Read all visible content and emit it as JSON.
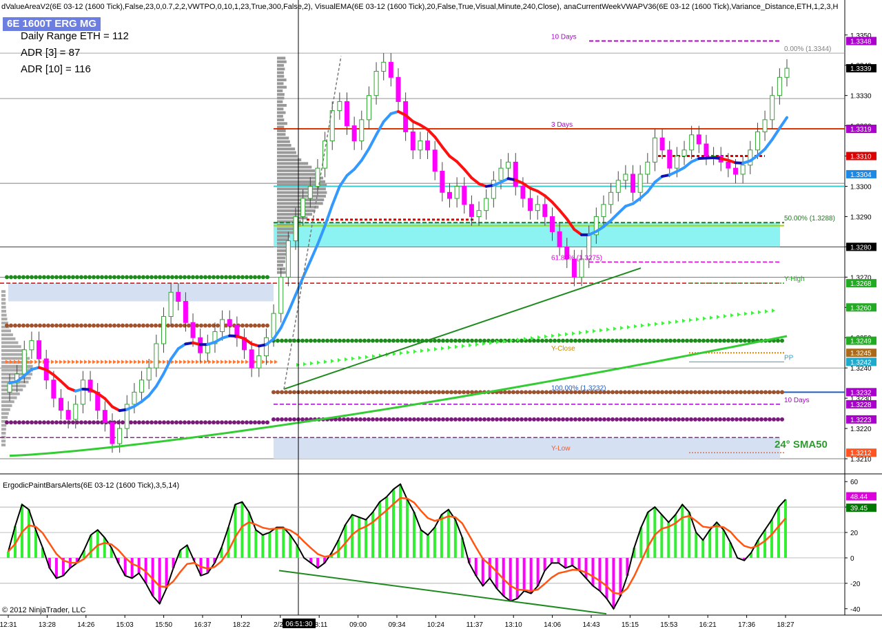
{
  "header": {
    "indicators": "dValueAreaV2(6E 03-12 (1600 Tick),False,23,0,0.7,2,2,VWTPO,0,10,1,23,True,300,False,2),  VisualEMA(6E 03-12 (1600 Tick),20,False,True,Visual,Minute,240,Close),  anaCurrentWeekVWAPV36(6E 03-12 (1600 Tick),Variance_Distance,ETH,1,2,3,H"
  },
  "symbol_badge": "6E 1600T ERG MG",
  "stats": [
    "Daily Range ETH = 112",
    "ADR [3] = 87",
    "ADR [10] = 116"
  ],
  "sma_label": "24° SMA50",
  "subpanel_title": "ErgodicPaintBarsAlerts(6E 03-12 (1600 Tick),3,5,14)",
  "copyright": "© 2012 NinjaTrader, LLC",
  "colors": {
    "up_candle": "#2ea52e",
    "down_candle": "#ff00ff",
    "ema_up": "#3399ff",
    "ema_down": "#ff1010",
    "ema_flat": "#1010b0",
    "sma": "#33cc33",
    "value_area": "#66eeee",
    "hist_up": "#33ee33",
    "hist_down": "#ff00ff"
  },
  "chart_data": [
    {
      "type": "candlestick",
      "name": "price",
      "ylim": [
        1.3205,
        1.3357
      ],
      "y_ticks": [
        "1.3210",
        "1.3220",
        "1.3230",
        "1.3240",
        "1.3250",
        "1.3260",
        "1.3270",
        "1.3280",
        "1.3290",
        "1.3300",
        "1.3310",
        "1.3320",
        "1.3330",
        "1.3340",
        "1.3350"
      ],
      "x_ticks": [
        "12:31",
        "13:28",
        "14:26",
        "15:03",
        "15:50",
        "16:37",
        "18:22",
        "2/28",
        "08:11",
        "09:00",
        "09:34",
        "10:24",
        "11:37",
        "13:10",
        "14:06",
        "14:43",
        "15:15",
        "15:53",
        "16:21",
        "17:36",
        "18:27"
      ],
      "crosshair_label": "06:51:30",
      "price_markers": [
        {
          "label": "1.3348",
          "color": "#aa00cc",
          "value": 1.3348
        },
        {
          "label": "1.3339",
          "color": "#000000",
          "value": 1.3339
        },
        {
          "label": "1.3319",
          "color": "#aa00cc",
          "value": 1.3319
        },
        {
          "label": "1.3310",
          "color": "#dd0000",
          "value": 1.331
        },
        {
          "label": "1.3304",
          "color": "#1e88e5",
          "value": 1.3304
        },
        {
          "label": "1.3280",
          "color": "#000000",
          "value": 1.328
        },
        {
          "label": "1.3268",
          "color": "#22aa22",
          "value": 1.3268
        },
        {
          "label": "1.3260",
          "color": "#22aa22",
          "value": 1.326
        },
        {
          "label": "1.3249",
          "color": "#22aa22",
          "value": 1.3249
        },
        {
          "label": "1.3245",
          "color": "#aa6a1a",
          "value": 1.3245
        },
        {
          "label": "1.3242",
          "color": "#1faacc",
          "value": 1.3242
        },
        {
          "label": "1.3232",
          "color": "#aa00cc",
          "value": 1.3232
        },
        {
          "label": "1.3228",
          "color": "#aa00cc",
          "value": 1.3228
        },
        {
          "label": "1.3223",
          "color": "#aa00cc",
          "value": 1.3223
        },
        {
          "label": "1.3212",
          "color": "#ff5522",
          "value": 1.3212
        }
      ],
      "level_labels": [
        {
          "text": "10 Days",
          "color": "#aa00cc",
          "value": 1.3348
        },
        {
          "text": "0.00% (1.3344)",
          "color": "#808080",
          "value": 1.3344
        },
        {
          "text": "3 Days",
          "color": "#aa00cc",
          "value": 1.3319
        },
        {
          "text": "50.00% (1.3288)",
          "color": "#227722",
          "value": 1.3288
        },
        {
          "text": "61.80% (1.3275)",
          "color": "#dd00dd",
          "value": 1.3275
        },
        {
          "text": "Y-High",
          "color": "#22aa22",
          "value": 1.3268
        },
        {
          "text": "Y-Close",
          "color": "#cc8800",
          "value": 1.3245
        },
        {
          "text": "PP",
          "color": "#1faacc",
          "value": 1.3242
        },
        {
          "text": "100.00% (1.3232)",
          "color": "#1e5bbf",
          "value": 1.3232
        },
        {
          "text": "10 Days",
          "color": "#aa00cc",
          "value": 1.3228
        },
        {
          "text": "Y-Low",
          "color": "#ff5522",
          "value": 1.3212
        }
      ],
      "close_path": [
        1.3235,
        1.3238,
        1.3246,
        1.3249,
        1.3243,
        1.3236,
        1.323,
        1.3226,
        1.3223,
        1.3228,
        1.3236,
        1.3232,
        1.3226,
        1.3222,
        1.3215,
        1.322,
        1.3228,
        1.3232,
        1.3236,
        1.324,
        1.3248,
        1.3257,
        1.3265,
        1.3262,
        1.3255,
        1.325,
        1.3245,
        1.3248,
        1.3252,
        1.3256,
        1.3254,
        1.325,
        1.3246,
        1.324,
        1.3244,
        1.325,
        1.3258,
        1.327,
        1.3282,
        1.329,
        1.3296,
        1.33,
        1.3306,
        1.3315,
        1.3325,
        1.3328,
        1.332,
        1.3315,
        1.3322,
        1.333,
        1.3338,
        1.3341,
        1.3336,
        1.3328,
        1.3318,
        1.3312,
        1.3315,
        1.3312,
        1.3305,
        1.3298,
        1.3296,
        1.33,
        1.3294,
        1.329,
        1.3292,
        1.3296,
        1.3302,
        1.3306,
        1.3308,
        1.33,
        1.3296,
        1.3292,
        1.3294,
        1.329,
        1.3285,
        1.328,
        1.3276,
        1.327,
        1.3276,
        1.3284,
        1.329,
        1.3294,
        1.3298,
        1.3302,
        1.3304,
        1.3298,
        1.3304,
        1.3308,
        1.3316,
        1.3312,
        1.3306,
        1.331,
        1.3312,
        1.3317,
        1.3314,
        1.331,
        1.331,
        1.3308,
        1.3306,
        1.3304,
        1.3307,
        1.3312,
        1.3318,
        1.3322,
        1.333,
        1.3336,
        1.3339
      ]
    },
    {
      "type": "bar",
      "name": "ergodic",
      "ylim": [
        -45,
        65
      ],
      "y_ticks": [
        "60",
        "40",
        "20",
        "0",
        "-20",
        "-40"
      ],
      "markers": [
        {
          "label": "48.44",
          "color": "#dd00dd",
          "value": 48.44
        },
        {
          "label": "39.45",
          "color": "#007700",
          "value": 39.45
        }
      ],
      "values": [
        5,
        25,
        42,
        38,
        22,
        8,
        -8,
        -16,
        -14,
        -8,
        -4,
        6,
        18,
        22,
        16,
        8,
        -4,
        -14,
        -16,
        -12,
        -20,
        -30,
        -36,
        -24,
        -8,
        6,
        10,
        -2,
        -14,
        -12,
        -4,
        8,
        24,
        42,
        44,
        36,
        22,
        18,
        20,
        24,
        24,
        18,
        10,
        0,
        -4,
        -8,
        -4,
        4,
        14,
        26,
        34,
        32,
        30,
        36,
        44,
        48,
        54,
        58,
        46,
        36,
        22,
        18,
        24,
        34,
        38,
        30,
        16,
        -4,
        -14,
        -22,
        -16,
        -24,
        -30,
        -34,
        -32,
        -26,
        -28,
        -22,
        -10,
        -4,
        -4,
        -8,
        -6,
        -10,
        -16,
        -22,
        -26,
        -32,
        -40,
        -30,
        -14,
        8,
        24,
        36,
        40,
        34,
        28,
        34,
        42,
        36,
        20,
        14,
        22,
        28,
        22,
        12,
        0,
        -2,
        4,
        14,
        22,
        30,
        40,
        46
      ]
    }
  ]
}
